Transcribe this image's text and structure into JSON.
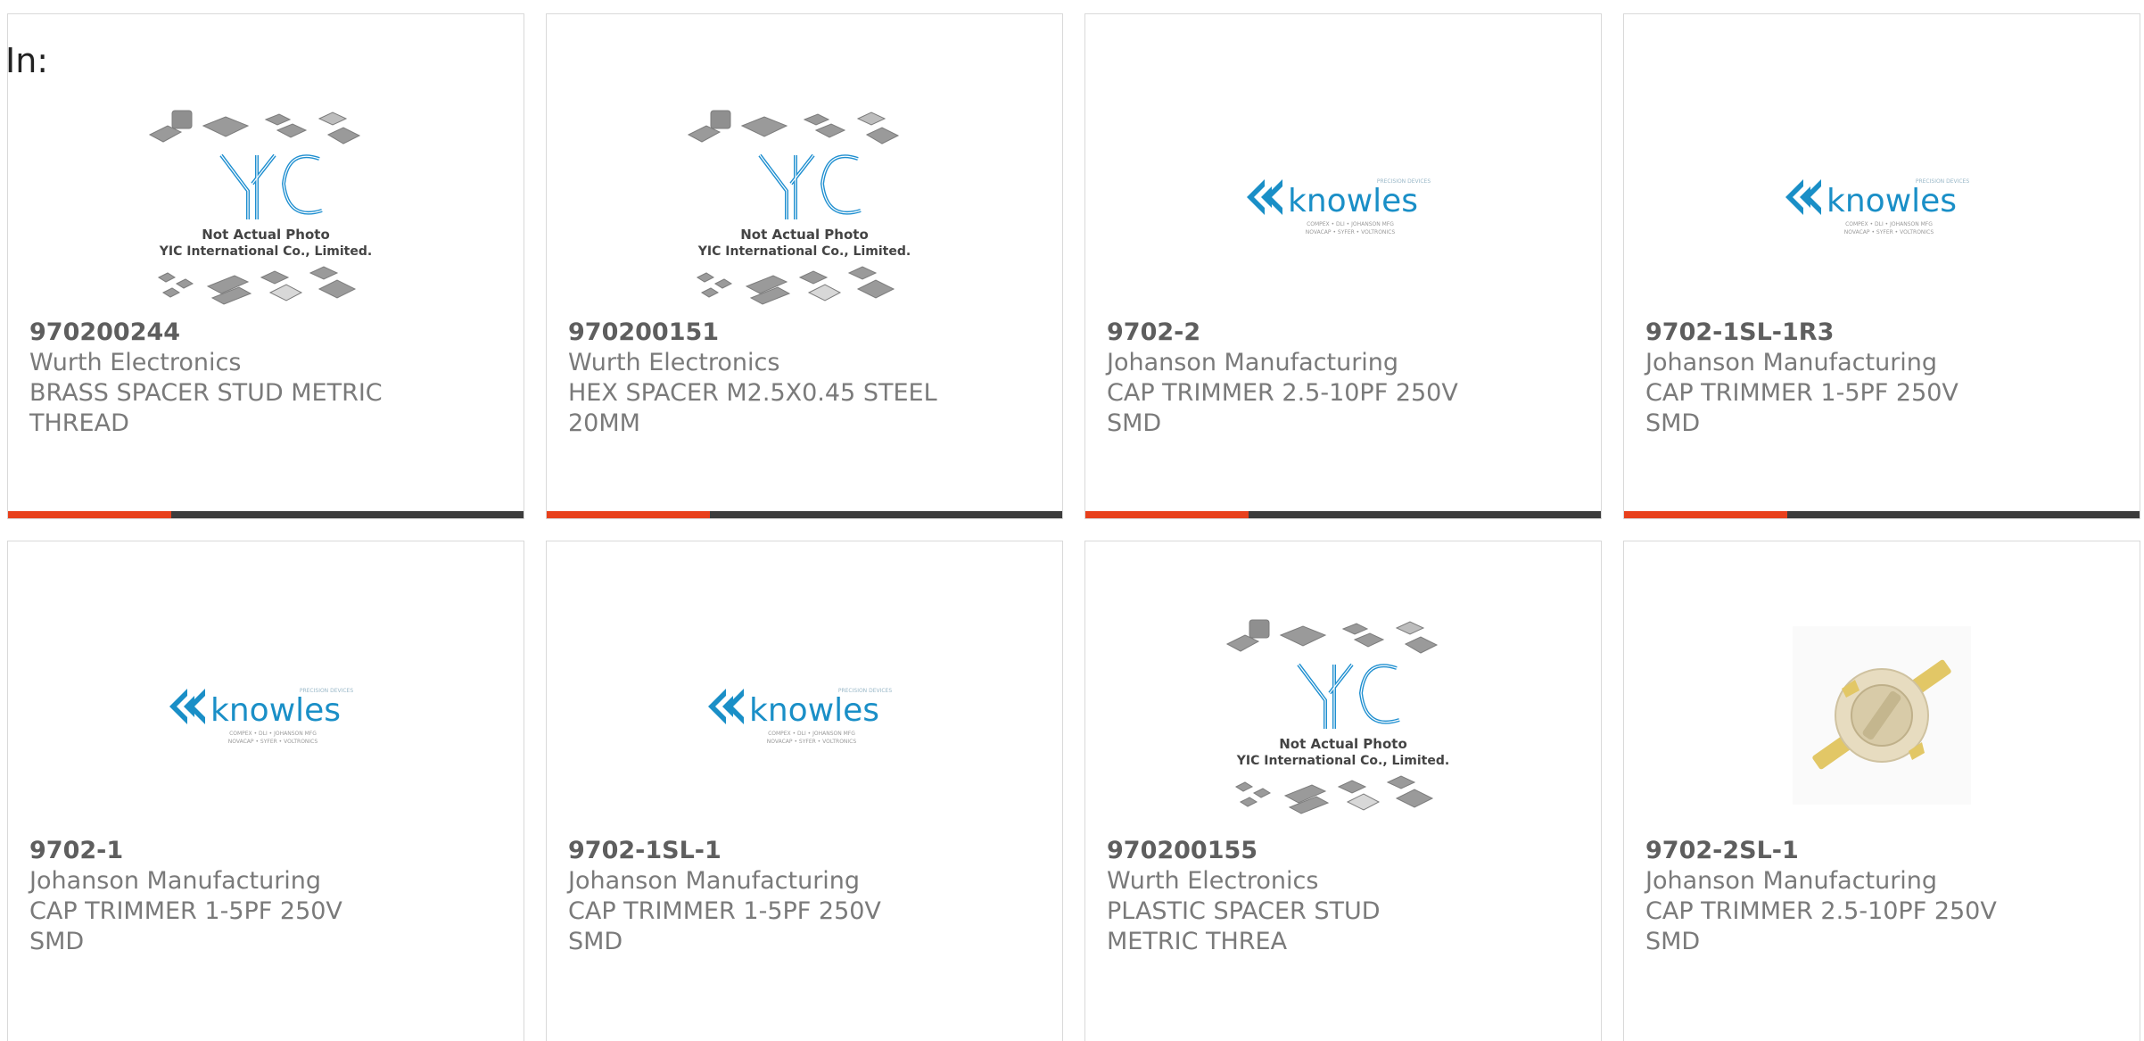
{
  "filter_label": "In:",
  "colors": {
    "accent": "#e8401c",
    "bar_dark": "#3c3c3c",
    "knowles_blue": "#1a8fc7",
    "yic_blue": "#1f8fd0"
  },
  "products": [
    {
      "part_number": "970200244",
      "manufacturer": "Wurth Electronics",
      "description": "BRASS SPACER STUD METRIC THREAD",
      "image": "yic-placeholder",
      "show_bar": true
    },
    {
      "part_number": "970200151",
      "manufacturer": "Wurth Electronics",
      "description": "HEX SPACER M2.5X0.45 STEEL 20MM",
      "image": "yic-placeholder",
      "show_bar": true
    },
    {
      "part_number": "9702-2",
      "manufacturer": "Johanson Manufacturing",
      "description": "CAP TRIMMER 2.5-10PF 250V SMD",
      "image": "knowles-logo",
      "show_bar": true
    },
    {
      "part_number": "9702-1SL-1R3",
      "manufacturer": "Johanson Manufacturing",
      "description": "CAP TRIMMER 1-5PF 250V SMD",
      "image": "knowles-logo",
      "show_bar": true
    },
    {
      "part_number": "9702-1",
      "manufacturer": "Johanson Manufacturing",
      "description": "CAP TRIMMER 1-5PF 250V SMD",
      "image": "knowles-logo",
      "show_bar": false
    },
    {
      "part_number": "9702-1SL-1",
      "manufacturer": "Johanson Manufacturing",
      "description": "CAP TRIMMER 1-5PF 250V SMD",
      "image": "knowles-logo",
      "show_bar": false
    },
    {
      "part_number": "970200155",
      "manufacturer": "Wurth Electronics",
      "description": "PLASTIC SPACER STUD METRIC THREA",
      "image": "yic-placeholder",
      "show_bar": false
    },
    {
      "part_number": "9702-2SL-1",
      "manufacturer": "Johanson Manufacturing",
      "description": "CAP TRIMMER 2.5-10PF 250V SMD",
      "image": "trimmer-photo",
      "show_bar": false
    }
  ],
  "yic_placeholder": {
    "line1": "Not Actual Photo",
    "line2": "YIC International Co., Limited."
  },
  "knowles_logo": {
    "wordmark": "knowles",
    "tag_top": "PRECISION DEVICES",
    "tag_line1": "COMPEX • DLI • JOHANSON MFG",
    "tag_line2": "NOVACAP • SYFER • VOLTRONICS"
  }
}
